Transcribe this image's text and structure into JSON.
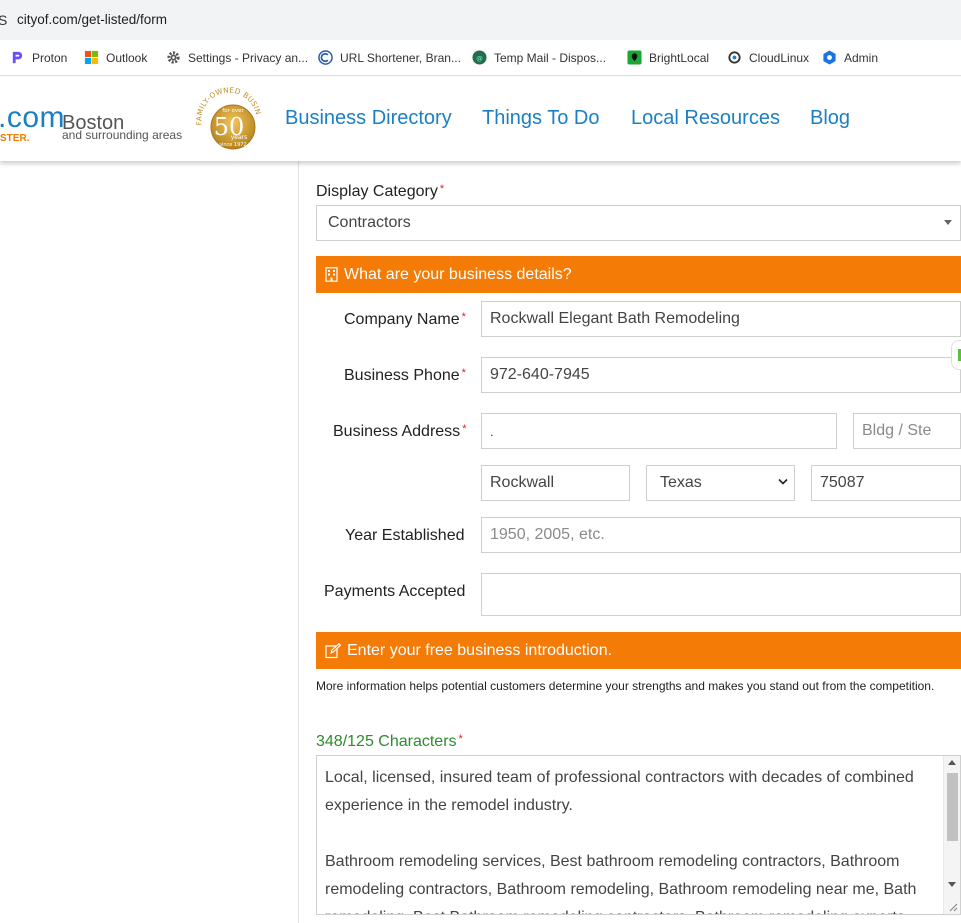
{
  "browser": {
    "url": "cityof.com/get-listed/form",
    "bookmarks": [
      {
        "label": "Proton",
        "icon": "proton-icon"
      },
      {
        "label": "Outlook",
        "icon": "microsoft-icon"
      },
      {
        "label": "Settings - Privacy an...",
        "icon": "gear-icon"
      },
      {
        "label": "URL Shortener, Bran...",
        "icon": "link-shortener-icon"
      },
      {
        "label": "Temp Mail - Dispos...",
        "icon": "temp-mail-icon"
      },
      {
        "label": "BrightLocal",
        "icon": "brightlocal-icon"
      },
      {
        "label": "CloudLinux",
        "icon": "cloudlinux-icon"
      },
      {
        "label": "Admin",
        "icon": "admin-icon"
      }
    ]
  },
  "header": {
    "logo_text": ".com",
    "logo_tagline": "STER.",
    "city": "Boston",
    "city_sub": "and surrounding areas",
    "badge": {
      "arc_text": "FAMILY-OWNED BUSINESS",
      "for_over": "for over",
      "number": "50",
      "years": "years",
      "since": "since 1972"
    },
    "nav": [
      "Business Directory",
      "Things To Do",
      "Local Resources",
      "Blog"
    ]
  },
  "form": {
    "display_category": {
      "label": "Display Category",
      "value": "Contractors"
    },
    "business_details_title": "What are your business details?",
    "company_name": {
      "label": "Company Name",
      "value": "Rockwall Elegant Bath Remodeling"
    },
    "business_phone": {
      "label": "Business Phone",
      "value": "972-640-7945"
    },
    "business_address": {
      "label": "Business Address",
      "street": ".",
      "suite_placeholder": "Bldg / Ste",
      "city": "Rockwall",
      "state": "Texas",
      "zip": "75087"
    },
    "year_established": {
      "label": "Year Established",
      "placeholder": "1950, 2005, etc."
    },
    "payments_accepted": {
      "label": "Payments Accepted",
      "value": ""
    },
    "intro_title": "Enter your free business introduction.",
    "intro_info": "More information helps potential customers determine your strengths and makes you stand out from the competition.",
    "char_count": "348/125 Characters",
    "intro_text": "Local, licensed, insured team of professional contractors with decades of combined experience in the remodel industry.\n\nBathroom remodeling services, Best bathroom remodeling contractors, Bathroom remodeling contractors, Bathroom remodeling, Bathroom remodeling near me, Bath remodeling, Best Bathroom remodeling contractors, Bathroom remodeling experts"
  },
  "colors": {
    "accent": "#f47b06",
    "link": "#1b7fc3",
    "success": "#2e8b2e",
    "required": "#d9241c"
  }
}
